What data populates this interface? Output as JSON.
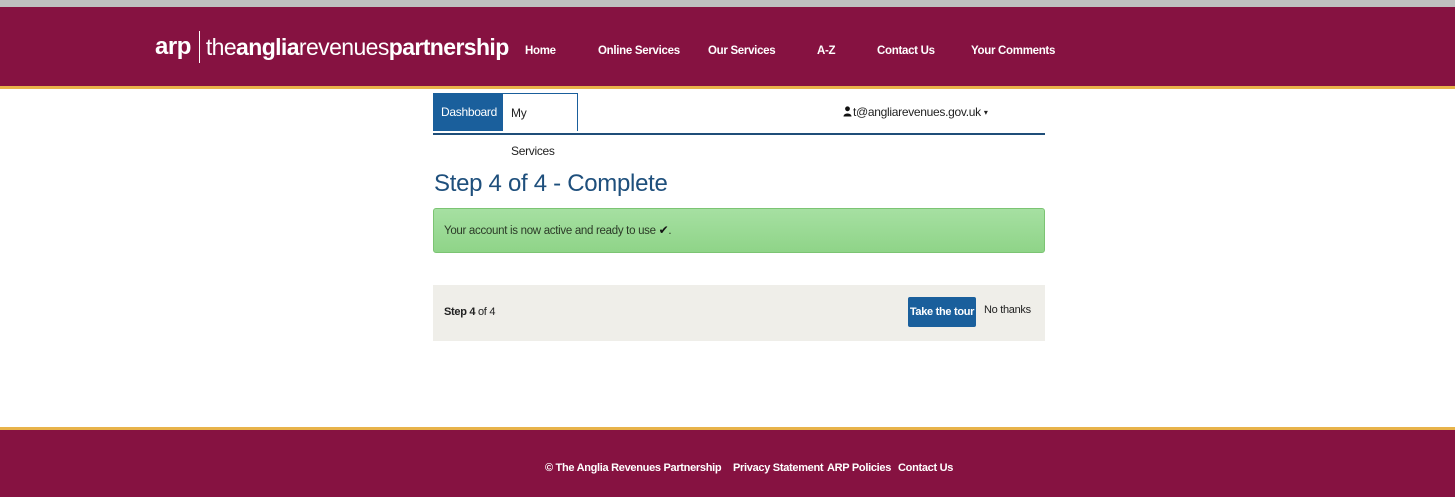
{
  "header": {
    "logo": {
      "short": "arp",
      "prefix": "the",
      "name1": "anglia",
      "name2": "revenues",
      "name3": "partnership"
    },
    "nav": [
      {
        "label": "Home"
      },
      {
        "label": "Online Services"
      },
      {
        "label": "Our Services"
      },
      {
        "label": "A-Z"
      },
      {
        "label": "Contact Us"
      },
      {
        "label": "Your Comments"
      }
    ]
  },
  "tabs": [
    {
      "label": "Dashboard",
      "active": true
    },
    {
      "label": "My Services",
      "active": false
    }
  ],
  "user": {
    "email": "t@angliarevenues.gov.uk",
    "icon": "user-icon"
  },
  "main": {
    "title": "Step 4 of 4 - Complete",
    "alert": {
      "text": "Your account is now active and ready to use",
      "icon": "checkmark-icon",
      "suffix": "."
    },
    "stepbar": {
      "step_word": "Step 4",
      "of_text": "of 4",
      "tour_button": "Take the tour",
      "no_thanks": "No thanks"
    }
  },
  "footer": {
    "copyright": "© The Anglia Revenues Partnership",
    "links": [
      {
        "label": "Privacy Statement"
      },
      {
        "label": "ARP Policies"
      },
      {
        "label": "Contact Us"
      }
    ]
  },
  "colors": {
    "brand": "#861241",
    "stripe": "#e8b34a",
    "primary": "#1a5f9c",
    "success_bg": "#a6e0a2",
    "panel_bg": "#efeee9"
  }
}
